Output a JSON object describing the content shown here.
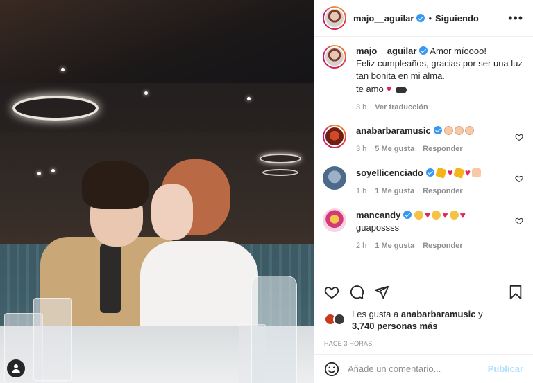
{
  "post": {
    "username": "majo__aguilar",
    "follow_status": "Siguiendo",
    "separator": "•"
  },
  "caption": {
    "username": "majo__aguilar",
    "line1": "Amor míoooo!",
    "line2": "Feliz cumpleaños, gracias por ser una luz tan bonita en mi alma.",
    "line3_text": "te amo",
    "time": "3 h",
    "translate_link": "Ver traducción"
  },
  "comments": [
    {
      "username": "anabarbaramusic",
      "text": "",
      "time": "3 h",
      "likes": "5 Me gusta",
      "reply": "Responder",
      "emojis": [
        "clap",
        "clap",
        "clap"
      ]
    },
    {
      "username": "soyellicenciado",
      "text": "",
      "time": "1 h",
      "likes": "1 Me gusta",
      "reply": "Responder",
      "emojis": [
        "party",
        "heart",
        "party",
        "heart",
        "pray"
      ]
    },
    {
      "username": "mancandy",
      "text": "guapossss",
      "time": "2 h",
      "likes": "1 Me gusta",
      "reply": "Responder",
      "emojis": [
        "love",
        "heart",
        "love",
        "heart",
        "love",
        "heart"
      ]
    }
  ],
  "likes": {
    "prefix": "Les gusta a",
    "user": "anabarbaramusic",
    "conj": "y",
    "others": "3,740 personas más"
  },
  "posted_ago": "HACE 3 HORAS",
  "add_comment": {
    "placeholder": "Añade un comentario...",
    "publish_label": "Publicar"
  },
  "colors": {
    "verified": "#3897f0",
    "heart": "#e0245e",
    "publish_disabled": "#b2dffc",
    "muted": "#8e8e8e"
  },
  "icons": {
    "more": "more-icon",
    "like": "heart-icon",
    "comment": "comment-icon",
    "share": "send-icon",
    "save": "bookmark-icon",
    "emoji": "smiley-icon",
    "tag": "user-tag-icon"
  }
}
